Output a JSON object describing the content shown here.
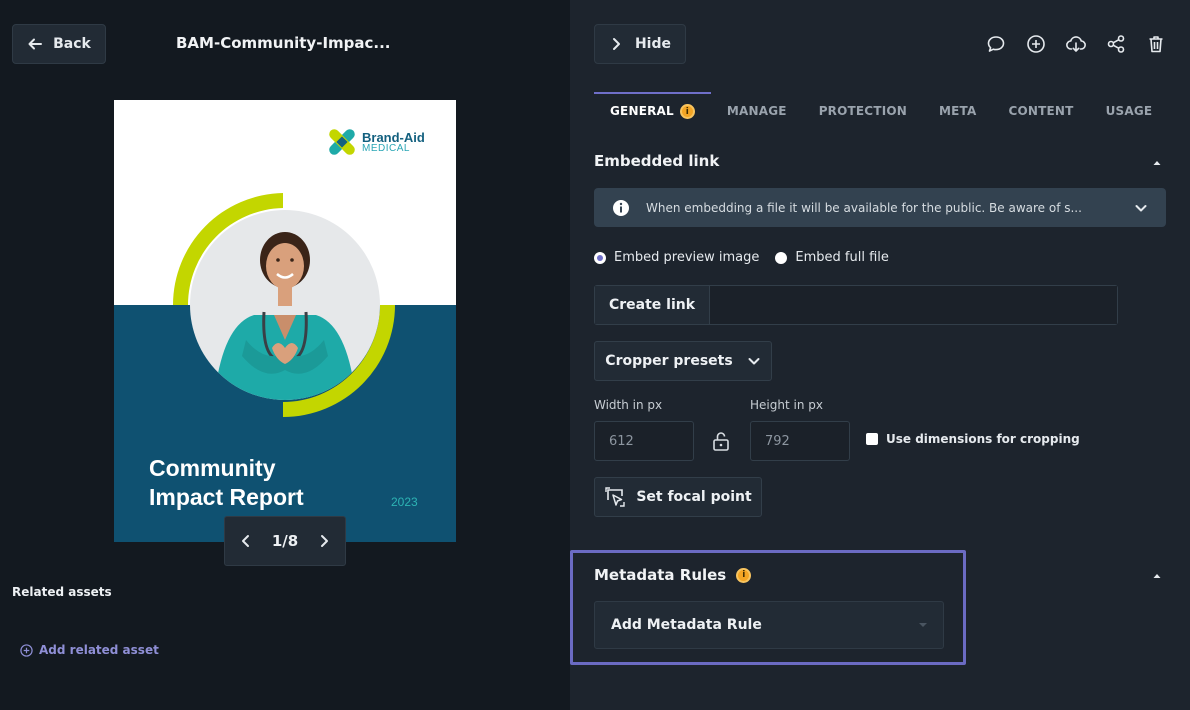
{
  "header": {
    "back_label": "Back",
    "file_title": "BAM-Community-Impac...",
    "hide_label": "Hide"
  },
  "toolbar": {
    "icons": [
      "comment-icon",
      "add-circle-icon",
      "cloud-download-icon",
      "share-icon",
      "trash-icon"
    ]
  },
  "preview": {
    "logo_line1": "Brand-Aid",
    "logo_line2": "MEDICAL",
    "cover_title_line1": "Community",
    "cover_title_line2": "Impact Report",
    "cover_year": "2023",
    "page_indicator": "1/8"
  },
  "related": {
    "label": "Related assets",
    "add_label": "Add related asset"
  },
  "tabs": [
    {
      "label": "GENERAL",
      "active": true
    },
    {
      "label": "MANAGE"
    },
    {
      "label": "PROTECTION"
    },
    {
      "label": "META"
    },
    {
      "label": "CONTENT"
    },
    {
      "label": "USAGE"
    }
  ],
  "embedded": {
    "title": "Embedded link",
    "notice": "When embedding a file it will be available for the public. Be aware of s...",
    "radio_preview": "Embed preview image",
    "radio_full": "Embed full file",
    "create_link": "Create link",
    "cropper_presets": "Cropper presets",
    "width_label": "Width in px",
    "width_value": "612",
    "height_label": "Height in px",
    "height_value": "792",
    "use_dimensions": "Use dimensions for cropping",
    "focal_point": "Set focal point"
  },
  "metadata": {
    "title": "Metadata Rules",
    "add_rule": "Add Metadata Rule"
  },
  "colors": {
    "accent": "#6f6fc9",
    "info_badge": "#f4a524",
    "panel_bg": "#1d242d",
    "left_bg": "#131920"
  }
}
